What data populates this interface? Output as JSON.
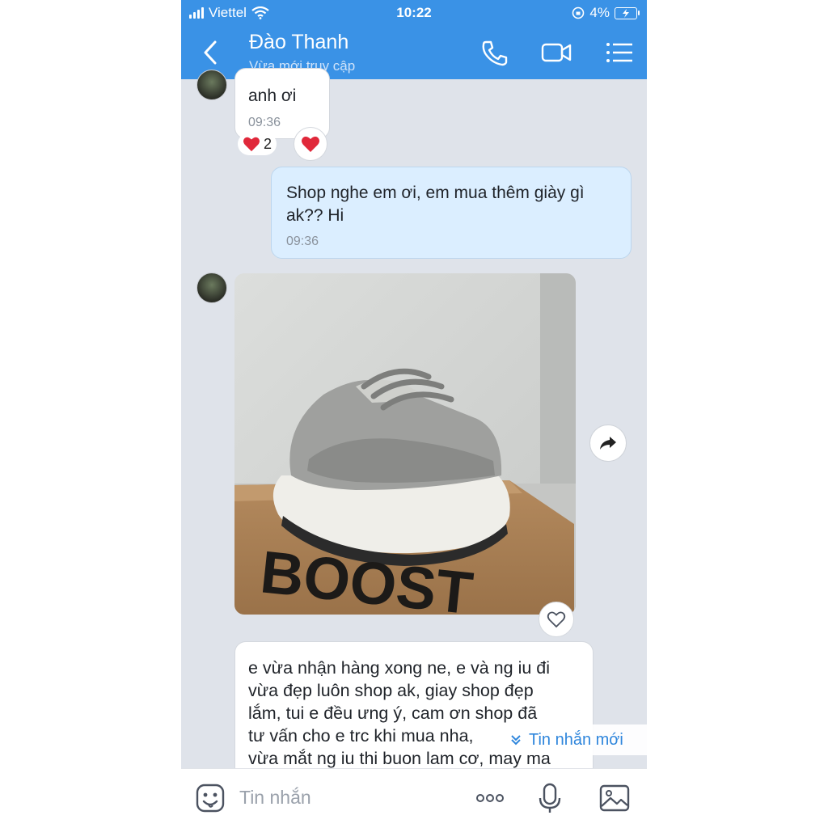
{
  "status_bar": {
    "carrier": "Viettel",
    "time": "10:22",
    "battery": "4%"
  },
  "header": {
    "contact_name": "Đào Thanh",
    "presence": "Vừa mới truy cập"
  },
  "messages": [
    {
      "direction": "in",
      "text": "anh ơi",
      "time": "09:36",
      "reaction_count": "2"
    },
    {
      "direction": "out",
      "text_line1": "Shop nghe em ơi, em mua thêm giày gì",
      "text_line2": "ak?? Hi",
      "time": "09:36"
    },
    {
      "direction": "in",
      "type": "image",
      "image_text": "BOOST"
    },
    {
      "direction": "in",
      "lines": [
        "e vừa nhận hàng xong ne, e và ng iu đi",
        "vừa đẹp luôn shop ak, giay shop đẹp",
        "lắm, tui e đều ưng ý, cam ơn shop đã",
        "tư vấn cho e trc khi mua nha,",
        "vừa mắt ng iu thi buon lam cơ, may ma"
      ]
    }
  ],
  "new_message_pill": "Tin nhắn mới",
  "composer": {
    "placeholder": "Tin nhắn"
  },
  "colors": {
    "header_blue": "#3a92e6",
    "outgoing_bubble": "#dbeeff",
    "chat_bg": "#dfe3ea",
    "heart_red": "#e0283a"
  },
  "icons": [
    "back-icon",
    "phone-icon",
    "video-icon",
    "menu-icon",
    "heart-icon",
    "share-icon",
    "chevrons-down-icon",
    "sticker-icon",
    "more-icon",
    "mic-icon",
    "image-icon"
  ]
}
